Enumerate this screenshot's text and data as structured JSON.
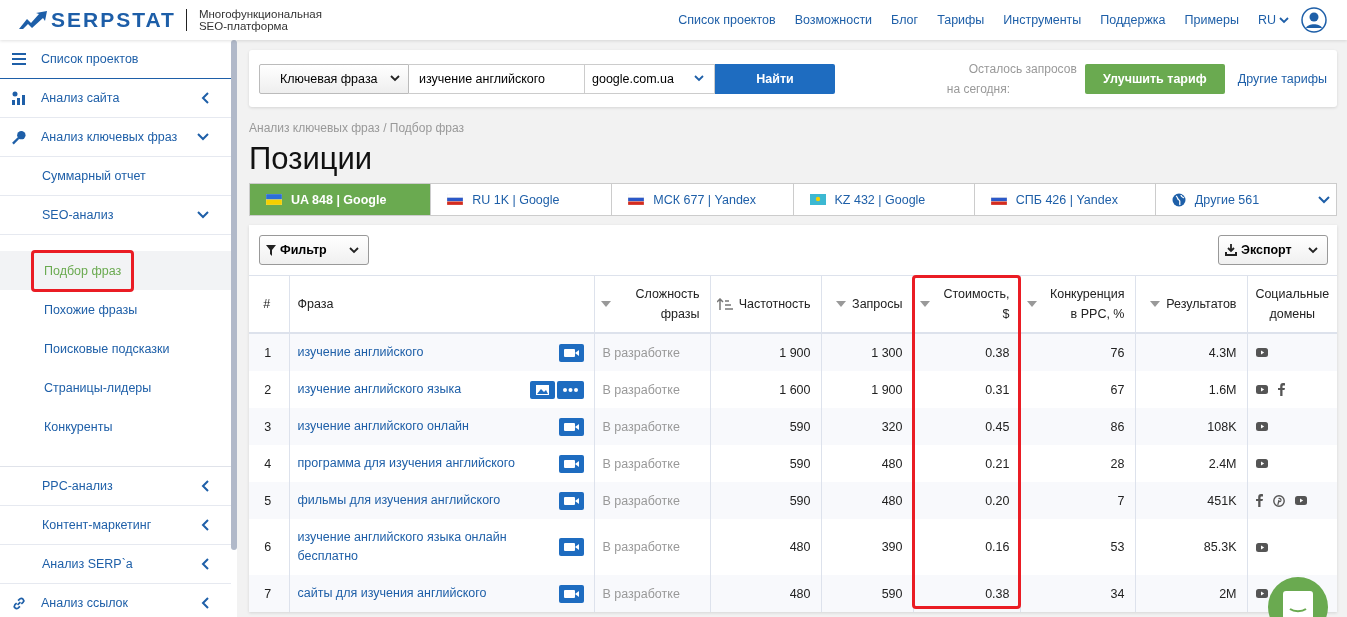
{
  "header": {
    "logo": "SERPSTAT",
    "tagline": [
      "Многофункциональная",
      "SEO-платформа"
    ],
    "nav": [
      "Список проектов",
      "Возможности",
      "Блог",
      "Тарифы",
      "Инструменты",
      "Поддержка",
      "Примеры"
    ],
    "language": "RU"
  },
  "sidebar": {
    "items": [
      {
        "label": "Список проектов",
        "kind": "menu"
      },
      {
        "label": "Анализ сайта",
        "kind": "chart",
        "expanded": false
      },
      {
        "label": "Анализ ключевых фраз",
        "kind": "key",
        "expanded": true,
        "children": [
          {
            "label": "Суммарный отчет"
          },
          {
            "label": "SEO-анализ",
            "expanded": true,
            "children": [
              {
                "label": "Подбор фраз",
                "selected": true,
                "highlighted": true
              },
              {
                "label": "Похожие фразы",
                "selected": false,
                "highlighted": false
              },
              {
                "label": "Поисковые подсказки",
                "selected": false,
                "highlighted": false
              },
              {
                "label": "Страницы-лидеры",
                "selected": false,
                "highlighted": false
              },
              {
                "label": "Конкуренты",
                "selected": false,
                "highlighted": false
              }
            ]
          },
          {
            "label": "PPC-анализ",
            "expanded": false
          },
          {
            "label": "Контент-маркетинг",
            "expanded": false
          },
          {
            "label": "Анализ SERP`а",
            "expanded": false
          }
        ]
      },
      {
        "label": "Анализ ссылок",
        "kind": "link",
        "expanded": false
      }
    ]
  },
  "search": {
    "type": "Ключевая фраза",
    "query": "изучение английского",
    "engine": "google.com.ua",
    "button": "Найти",
    "quota": [
      "Осталось запросов",
      "на сегодня:"
    ],
    "upgrade": "Улучшить тариф",
    "other_plans": "Другие тарифы"
  },
  "breadcrumb": "Анализ ключевых фраз / Подбор фраз",
  "title": "Позиции",
  "tabs": [
    {
      "label": "UA 848 | Google",
      "kind": "ua",
      "selected": true
    },
    {
      "label": "RU 1K | Google",
      "kind": "ru",
      "selected": false
    },
    {
      "label": "МСК 677 | Yandex",
      "kind": "ru",
      "selected": false
    },
    {
      "label": "KZ 432 | Google",
      "kind": "kz",
      "selected": false
    },
    {
      "label": "СПБ 426 | Yandex",
      "kind": "ru",
      "selected": false
    },
    {
      "label": "Другие 561",
      "kind": "globe",
      "selected": false
    }
  ],
  "toolbar": {
    "filter": "Фильтр",
    "export": "Экспорт"
  },
  "table": {
    "columns": [
      {
        "label": "#",
        "kind": "plain",
        "highlighted": false
      },
      {
        "label": "Фраза",
        "kind": "plain",
        "highlighted": false
      },
      {
        "label": "Сложность фразы",
        "kind": "sortable",
        "highlighted": false
      },
      {
        "label": "Частотность",
        "kind": "sorted",
        "highlighted": false
      },
      {
        "label": "Запросы",
        "kind": "sortable",
        "highlighted": false
      },
      {
        "label": "Стоимость, $",
        "kind": "sortable",
        "highlighted": true
      },
      {
        "label": "Конкуренция в PPC, %",
        "kind": "sortable",
        "highlighted": false
      },
      {
        "label": "Результатов",
        "kind": "sortable",
        "highlighted": false
      },
      {
        "label": "Социальные домены",
        "kind": "plain",
        "highlighted": false
      }
    ],
    "rows": [
      {
        "num": "1",
        "phrase": "изучение английского",
        "features": [
          {
            "kind": "video"
          }
        ],
        "difficulty": "В разработке",
        "volume": "1 900",
        "queries": "1 300",
        "cost": "0.38",
        "competition": "76",
        "results": "4.3M",
        "social": [
          {
            "kind": "youtube"
          }
        ]
      },
      {
        "num": "2",
        "phrase": "изучение английского языка",
        "features": [
          {
            "kind": "image"
          },
          {
            "kind": "more"
          }
        ],
        "difficulty": "В разработке",
        "volume": "1 600",
        "queries": "1 900",
        "cost": "0.31",
        "competition": "67",
        "results": "1.6M",
        "social": [
          {
            "kind": "youtube"
          },
          {
            "kind": "facebook"
          }
        ]
      },
      {
        "num": "3",
        "phrase": "изучение английского онлайн",
        "features": [
          {
            "kind": "video"
          }
        ],
        "difficulty": "В разработке",
        "volume": "590",
        "queries": "320",
        "cost": "0.45",
        "competition": "86",
        "results": "108K",
        "social": [
          {
            "kind": "youtube"
          }
        ]
      },
      {
        "num": "4",
        "phrase": "программа для изучения английского",
        "features": [
          {
            "kind": "video"
          }
        ],
        "difficulty": "В разработке",
        "volume": "590",
        "queries": "480",
        "cost": "0.21",
        "competition": "28",
        "results": "2.4M",
        "social": [
          {
            "kind": "youtube"
          }
        ]
      },
      {
        "num": "5",
        "phrase": "фильмы для изучения английского",
        "features": [
          {
            "kind": "video"
          }
        ],
        "difficulty": "В разработке",
        "volume": "590",
        "queries": "480",
        "cost": "0.20",
        "competition": "7",
        "results": "451K",
        "social": [
          {
            "kind": "facebook"
          },
          {
            "kind": "pinterest"
          },
          {
            "kind": "youtube"
          }
        ]
      },
      {
        "num": "6",
        "phrase": "изучение английского языка онлайн бесплатно",
        "features": [
          {
            "kind": "video"
          }
        ],
        "difficulty": "В разработке",
        "volume": "480",
        "queries": "390",
        "cost": "0.16",
        "competition": "53",
        "results": "85.3K",
        "social": [
          {
            "kind": "youtube"
          }
        ]
      },
      {
        "num": "7",
        "phrase": "сайты для изучения английского",
        "features": [
          {
            "kind": "video"
          }
        ],
        "difficulty": "В разработке",
        "volume": "480",
        "queries": "590",
        "cost": "0.38",
        "competition": "34",
        "results": "2M",
        "social": [
          {
            "kind": "youtube"
          }
        ]
      }
    ]
  }
}
